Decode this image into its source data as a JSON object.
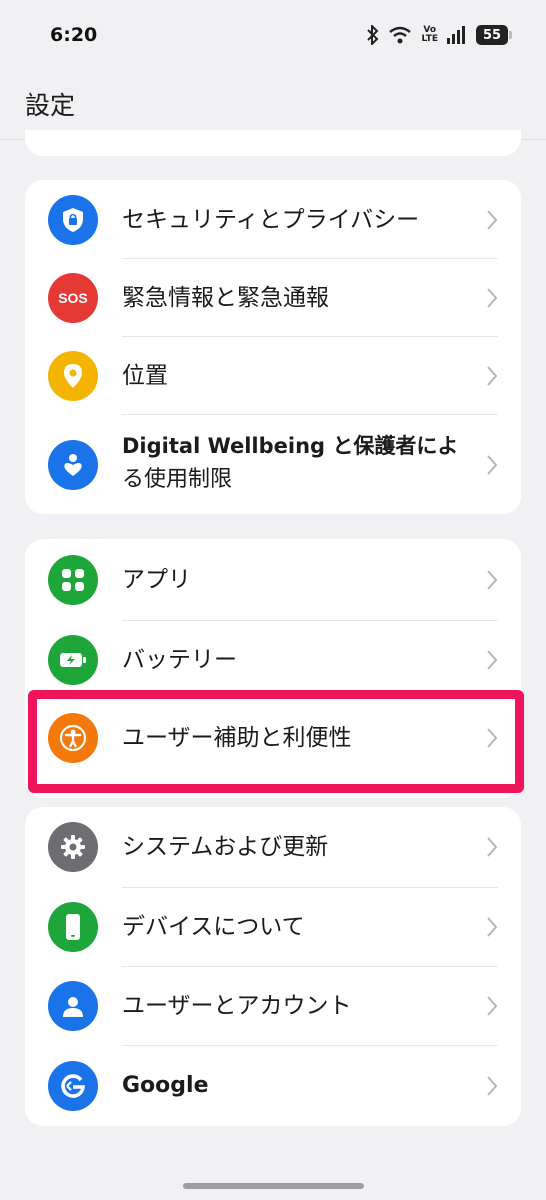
{
  "status_bar": {
    "time": "6:20",
    "volte": "Vo\nLTE",
    "battery": "55"
  },
  "header": {
    "title": "設定"
  },
  "group1": [
    {
      "label": "セキュリティとプライバシー",
      "icon": "shield-lock-icon",
      "color": "#1a73e8"
    },
    {
      "label": "緊急情報と緊急通報",
      "icon": "sos-icon",
      "color": "#e53935",
      "icon_text": "SOS"
    },
    {
      "label": "位置",
      "icon": "location-pin-icon",
      "color": "#f5b400"
    },
    {
      "label": "Digital Wellbeing と保護者によ\nる使用制限",
      "label_line1": "Digital Wellbeing と保護者によ",
      "label_line2": "る使用制限",
      "icon": "heart-person-icon",
      "color": "#1a73e8"
    }
  ],
  "group2": [
    {
      "label": "アプリ",
      "icon": "apps-grid-icon",
      "color": "#1fa63a"
    },
    {
      "label": "バッテリー",
      "icon": "battery-icon",
      "color": "#1fa63a"
    },
    {
      "label": "ユーザー補助と利便性",
      "icon": "accessibility-icon",
      "color": "#f5780a"
    }
  ],
  "group3": [
    {
      "label": "システムおよび更新",
      "icon": "gear-icon",
      "color": "#6e6e72"
    },
    {
      "label": "デバイスについて",
      "icon": "phone-icon",
      "color": "#1fa63a"
    },
    {
      "label": "ユーザーとアカウント",
      "icon": "user-icon",
      "color": "#1a73e8"
    },
    {
      "label": "Google",
      "icon": "google-icon",
      "color": "#1a73e8"
    }
  ],
  "highlight_color": "#f0145a"
}
